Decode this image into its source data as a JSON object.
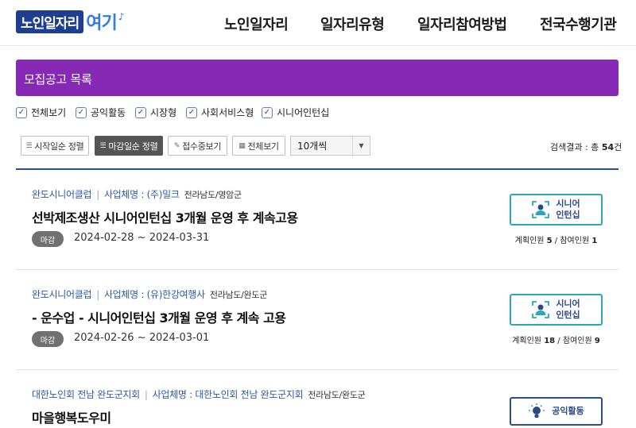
{
  "header": {
    "logo_main": "노인일자리",
    "logo_accent": "여기",
    "nav": [
      "노인일자리",
      "일자리유형",
      "일자리참여방법",
      "전국수행기관"
    ]
  },
  "banner": {
    "title": "모집공고 목록"
  },
  "filters": [
    {
      "label": "전체보기",
      "checked": true
    },
    {
      "label": "공익활동",
      "checked": true
    },
    {
      "label": "시장형",
      "checked": true
    },
    {
      "label": "사회서비스형",
      "checked": true
    },
    {
      "label": "시니어인턴십",
      "checked": true
    }
  ],
  "toolbar": {
    "sort_start": "시작일순 정렬",
    "sort_end": "마감일순 정렬",
    "view_open": "접수중보기",
    "view_all": "전체보기",
    "page_size": "10개씩",
    "result_prefix": "검색결과 : 총",
    "result_count": "54",
    "result_suffix": "건"
  },
  "jobs": [
    {
      "org": "완도시니어클럽",
      "biz": "사업체명 : (주)밀크",
      "region": "전라남도/영암군",
      "title": "선박제조생산 시니어인턴십 3개월 운영 후 계속고용",
      "status": "마감",
      "period": "2024-02-28 ~ 2024-03-31",
      "type_line1": "시니어",
      "type_line2": "인턴십",
      "plan_label": "계획인원",
      "plan": "5",
      "join_label": "참여인원",
      "join": "1"
    },
    {
      "org": "완도시니어클럽",
      "biz": "사업체명 : (유)한강여행사",
      "region": "전라남도/완도군",
      "title": "- 운수업 - 시니어인턴십 3개월 운영 후 계속 고용",
      "status": "마감",
      "period": "2024-02-26 ~ 2024-03-01",
      "type_line1": "시니어",
      "type_line2": "인턴십",
      "plan_label": "계획인원",
      "plan": "18",
      "join_label": "참여인원",
      "join": "9"
    },
    {
      "org": "대한노인회 전남 완도군지회",
      "biz": "사업체명 : 대한노인회 전남 완도군지회",
      "region": "전라남도/완도군",
      "title": "마을행복도우미",
      "type_line1": "공익활동"
    }
  ],
  "colors": {
    "banner": "#8629b5",
    "accent_blue": "#2b4e8c",
    "intern_border": "#29a8b9",
    "status_gray": "#707070"
  }
}
